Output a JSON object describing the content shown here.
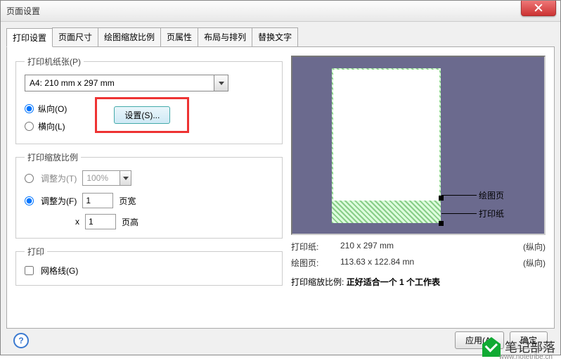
{
  "window": {
    "title": "页面设置"
  },
  "tabs": [
    "打印设置",
    "页面尺寸",
    "绘图缩放比例",
    "页属性",
    "布局与排列",
    "替换文字"
  ],
  "printer": {
    "legend": "打印机纸张(P)",
    "paper": "A4:  210 mm x 297 mm",
    "portrait": "纵向(O)",
    "landscape": "横向(L)",
    "settings_btn": "设置(S)..."
  },
  "zoom": {
    "legend": "打印缩放比例",
    "adjust_t": "调整为(T)",
    "percent": "100%",
    "adjust_f": "调整为(F)",
    "pages_wide_value": "1",
    "pages_wide_label": "页宽",
    "x_label": "x",
    "pages_tall_value": "1",
    "pages_tall_label": "页高"
  },
  "print_section": {
    "legend": "打印",
    "gridlines": "网格线(G)"
  },
  "preview": {
    "drawing_page": "绘图页",
    "print_paper": "打印纸"
  },
  "info": {
    "paper_label": "打印纸:",
    "paper_size": "210 x 297 mm",
    "paper_orient": "(纵向)",
    "drawing_label": "绘图页:",
    "drawing_size": "113.63 x 122.84 mn",
    "drawing_orient": "(纵向)",
    "fit_label": "打印缩放比例:",
    "fit_value": "正好适合一个 1 个工作表"
  },
  "buttons": {
    "apply": "应用(A)",
    "ok": "确定"
  },
  "watermark": {
    "text": "笔记部落",
    "sub": "www.notetribe.cn"
  }
}
